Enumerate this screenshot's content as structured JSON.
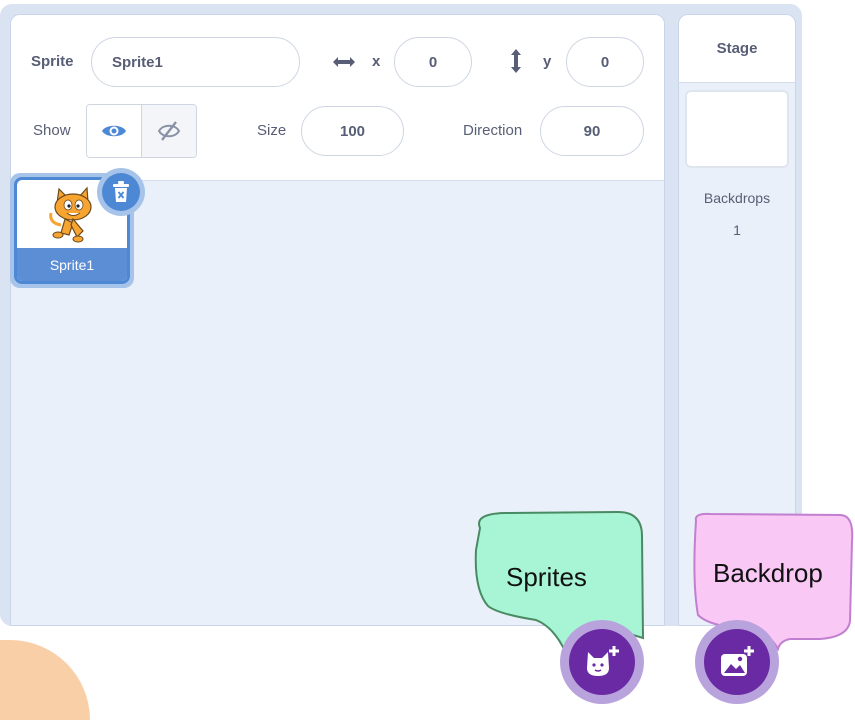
{
  "sprite_info": {
    "sprite_label": "Sprite",
    "sprite_name": "Sprite1",
    "x_label": "x",
    "x_value": "0",
    "y_label": "y",
    "y_value": "0",
    "show_label": "Show",
    "show_visible": true,
    "size_label": "Size",
    "size_value": "100",
    "direction_label": "Direction",
    "direction_value": "90"
  },
  "sprites": [
    {
      "name": "Sprite1",
      "selected": true
    }
  ],
  "stage": {
    "title": "Stage",
    "backdrops_label": "Backdrops",
    "backdrops_count": "1"
  },
  "callouts": {
    "sprites_label": "Sprites",
    "backdrop_label": "Backdrop"
  },
  "colors": {
    "accent_blue": "#4d88d4",
    "fab_purple": "#6a2aa3",
    "sprites_bubble": "#a8f5d6",
    "backdrop_bubble": "#f9c8f5"
  }
}
